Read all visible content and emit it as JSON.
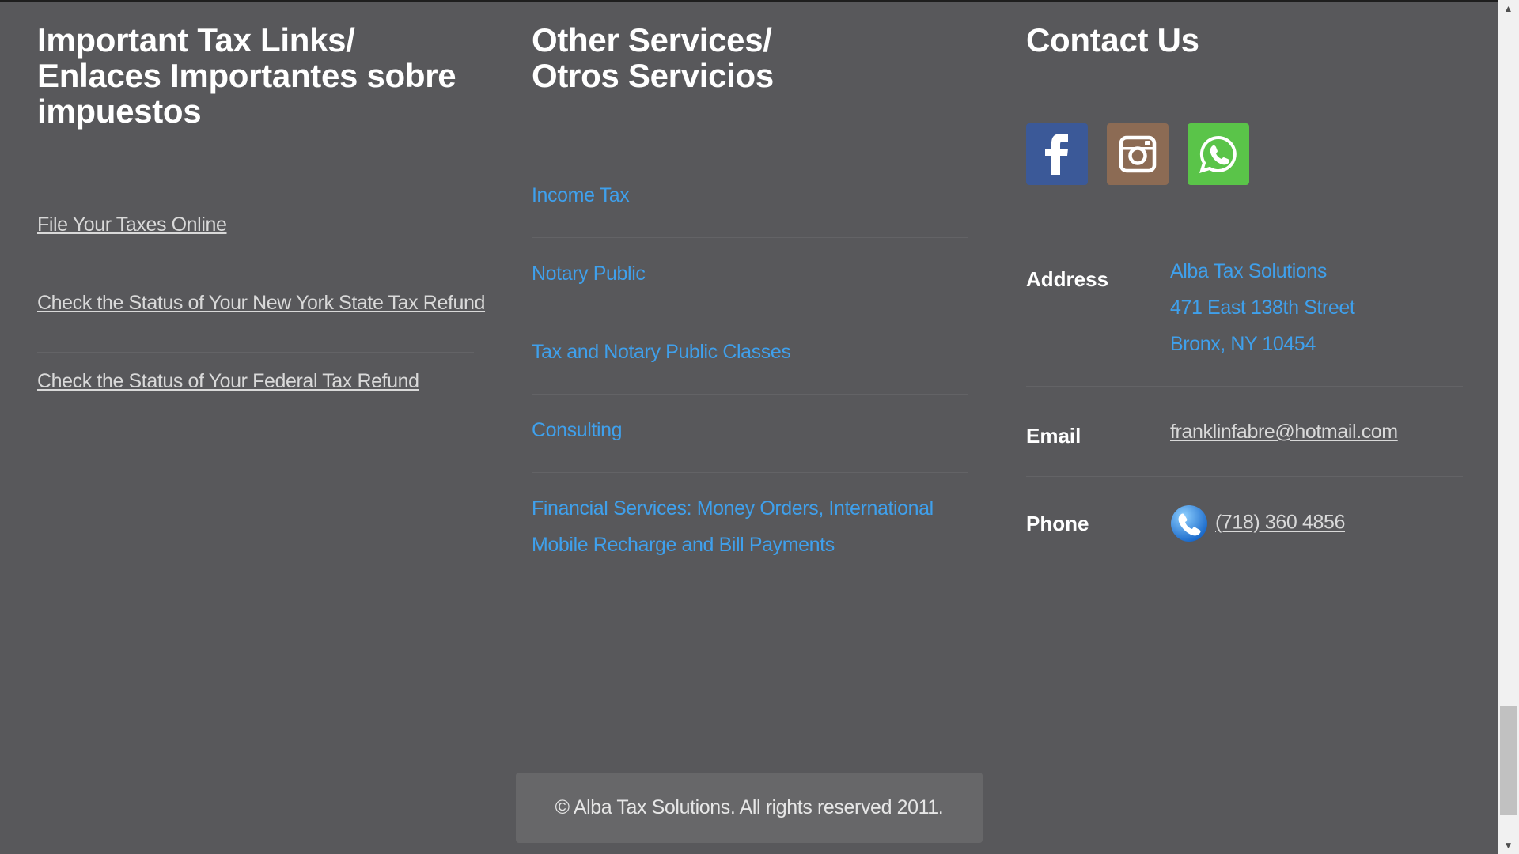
{
  "tax_links": {
    "heading": "Important Tax Links/\nEnlaces Importantes sobre impuestos",
    "items": [
      {
        "label": "File Your Taxes Online"
      },
      {
        "label": "Check the Status of Your New York State Tax Refund"
      },
      {
        "label": "Check the Status of Your Federal Tax Refund"
      }
    ]
  },
  "services": {
    "heading": "Other Services/\nOtros Servicios",
    "items": [
      {
        "label": "Income Tax"
      },
      {
        "label": "Notary Public"
      },
      {
        "label": "Tax and Notary Public Classes"
      },
      {
        "label": "Consulting"
      },
      {
        "label": "Financial Services: Money Orders, International Mobile Recharge and Bill Payments"
      }
    ]
  },
  "contact": {
    "heading": "Contact Us",
    "social": [
      {
        "name": "facebook",
        "icon": "facebook-icon",
        "color": "#3b5998"
      },
      {
        "name": "instagram",
        "icon": "instagram-icon",
        "color": "#8c6b54"
      },
      {
        "name": "whatsapp",
        "icon": "whatsapp-icon",
        "color": "#5ac449"
      }
    ],
    "address_label": "Address",
    "address_lines": [
      "Alba Tax Solutions",
      "471 East 138th Street",
      "Bronx, NY 10454"
    ],
    "email_label": "Email",
    "email": "franklinfabre@hotmail.com",
    "phone_label": "Phone",
    "phone": "(718) 360 4856"
  },
  "footer": {
    "copyright": "© Alba Tax Solutions. All rights reserved 2011."
  },
  "colors": {
    "background": "#58585b",
    "link_blue": "#3fa0ec",
    "link_gray": "#d9d9d9",
    "heading": "#ffffff"
  }
}
